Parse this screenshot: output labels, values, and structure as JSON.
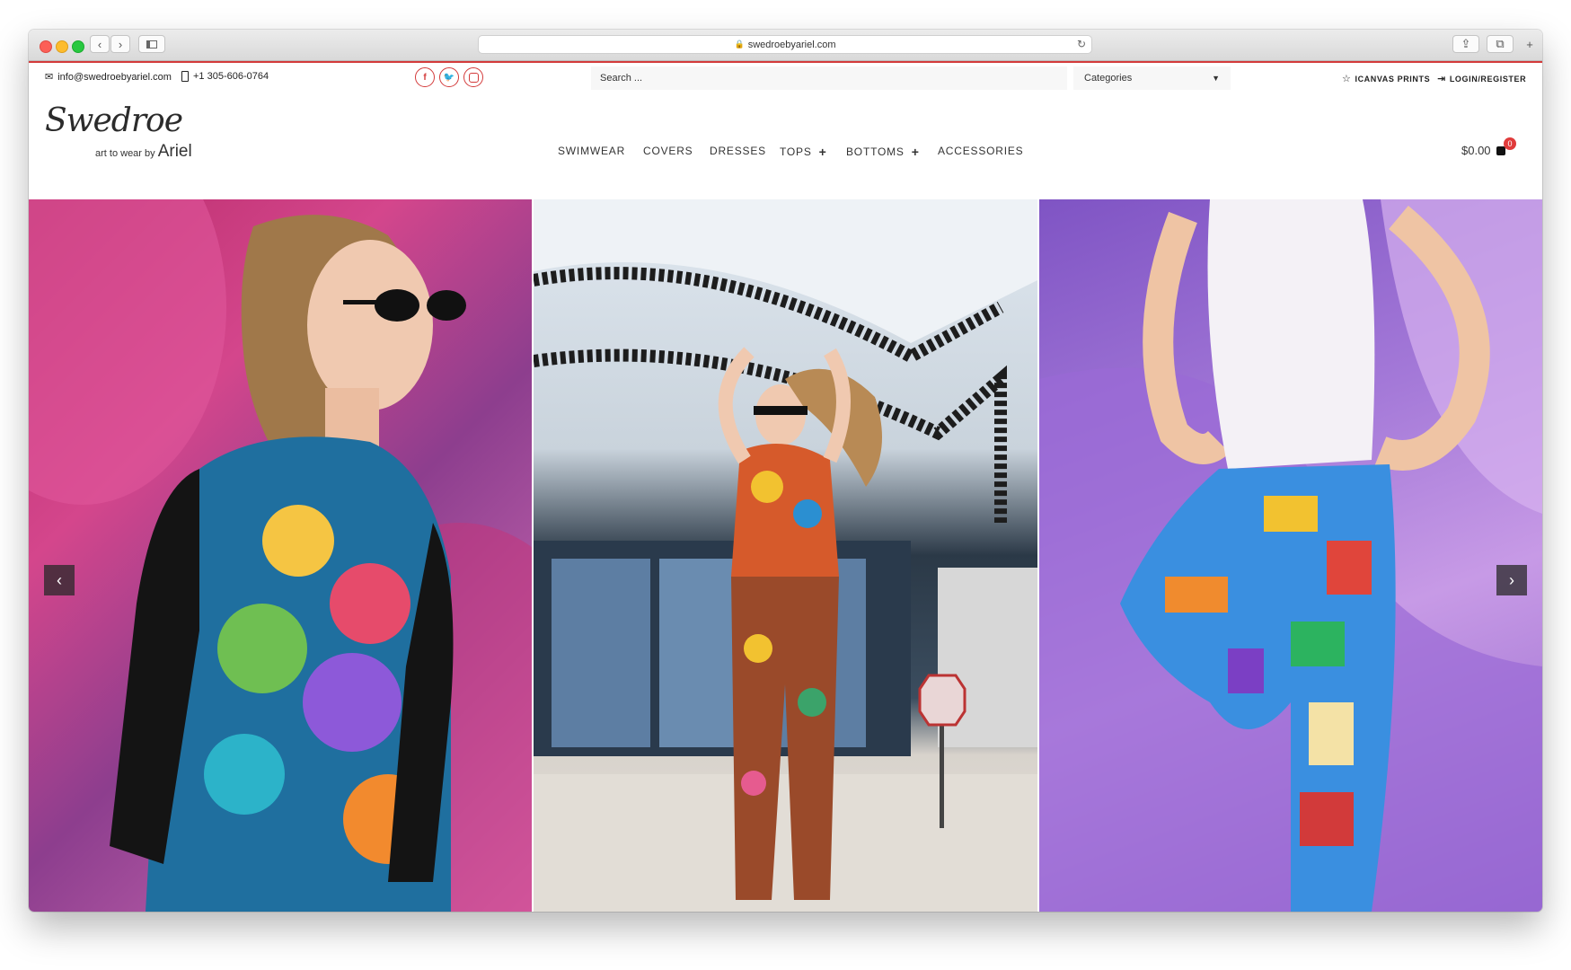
{
  "browser": {
    "url": "swedroebyariel.com"
  },
  "topbar": {
    "email": "info@swedroebyariel.com",
    "phone": "+1 305-606-0764",
    "social": [
      "f",
      "t",
      "ig"
    ],
    "search_placeholder": "Search ...",
    "categories_label": "Categories",
    "canvas_prints": "ICANVAS PRINTS",
    "login": "LOGIN/REGISTER"
  },
  "header": {
    "logo_script": "Swedroe",
    "logo_tag": "art to wear by",
    "logo_name": "Ariel",
    "nav": [
      {
        "label": "SWIMWEAR",
        "plus": ""
      },
      {
        "label": "COVERS",
        "plus": ""
      },
      {
        "label": "DRESSES",
        "plus": ""
      },
      {
        "label": "TOPS",
        "plus": "+"
      },
      {
        "label": "BOTTOMS",
        "plus": "+"
      },
      {
        "label": "ACCESSORIES",
        "plus": ""
      }
    ],
    "cart_total": "$0.00",
    "cart_count": "0"
  },
  "slider": {
    "prev_symbol": "‹",
    "next_symbol": "›"
  },
  "colors": {
    "accent": "#d33a3a"
  }
}
